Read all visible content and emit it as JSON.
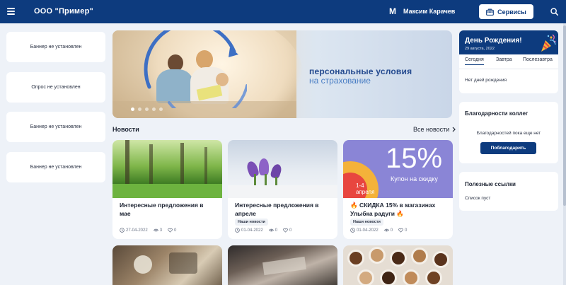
{
  "header": {
    "brand": "ООО \"Пример\"",
    "user_initial": "М",
    "user_name": "Максим Карачев",
    "services_label": "Сервисы"
  },
  "left_banners": [
    "Баннер не установлен",
    "Опрос не установлен",
    "Баннер не установлен",
    "Баннер не установлен"
  ],
  "hero": {
    "line1": "персональные условия",
    "line2": "на страхование",
    "slides": 5,
    "active_slide": 1
  },
  "news": {
    "section_title": "Новости",
    "all_label": "Все новости",
    "cards": [
      {
        "title": "Интересные предложения в мае",
        "tag": "",
        "date": "27-04-2022",
        "views": "3",
        "likes": "0"
      },
      {
        "title": "Интересные предложения в апреле",
        "tag": "Наши новости",
        "date": "01-04-2022",
        "views": "0",
        "likes": "0"
      },
      {
        "title": "🔥 СКИДКА 15% в магазинах Улыбка радуги 🔥",
        "tag": "Наши новости",
        "date": "01-04-2022",
        "views": "0",
        "likes": "0",
        "promo": {
          "big": "15%",
          "sub": "Купон на скидку",
          "corner": "1-4 апреля"
        }
      }
    ]
  },
  "birthday": {
    "title": "День Рождения!",
    "date": "29 августа, 2022",
    "tabs": [
      "Сегодня",
      "Завтра",
      "Послезавтра"
    ],
    "active_tab": 0,
    "empty": "Нет дней рождения"
  },
  "thanks": {
    "title": "Благодарности коллег",
    "empty": "Благодарностей пока еще нет",
    "button": "Поблагодарить"
  },
  "links": {
    "title": "Полезные ссылки",
    "empty": "Список пуст"
  },
  "colors": {
    "primary": "#0d3b7e",
    "background": "#eef2f8",
    "promo_purple": "#8a85d6",
    "promo_orange": "#f4b23a"
  }
}
